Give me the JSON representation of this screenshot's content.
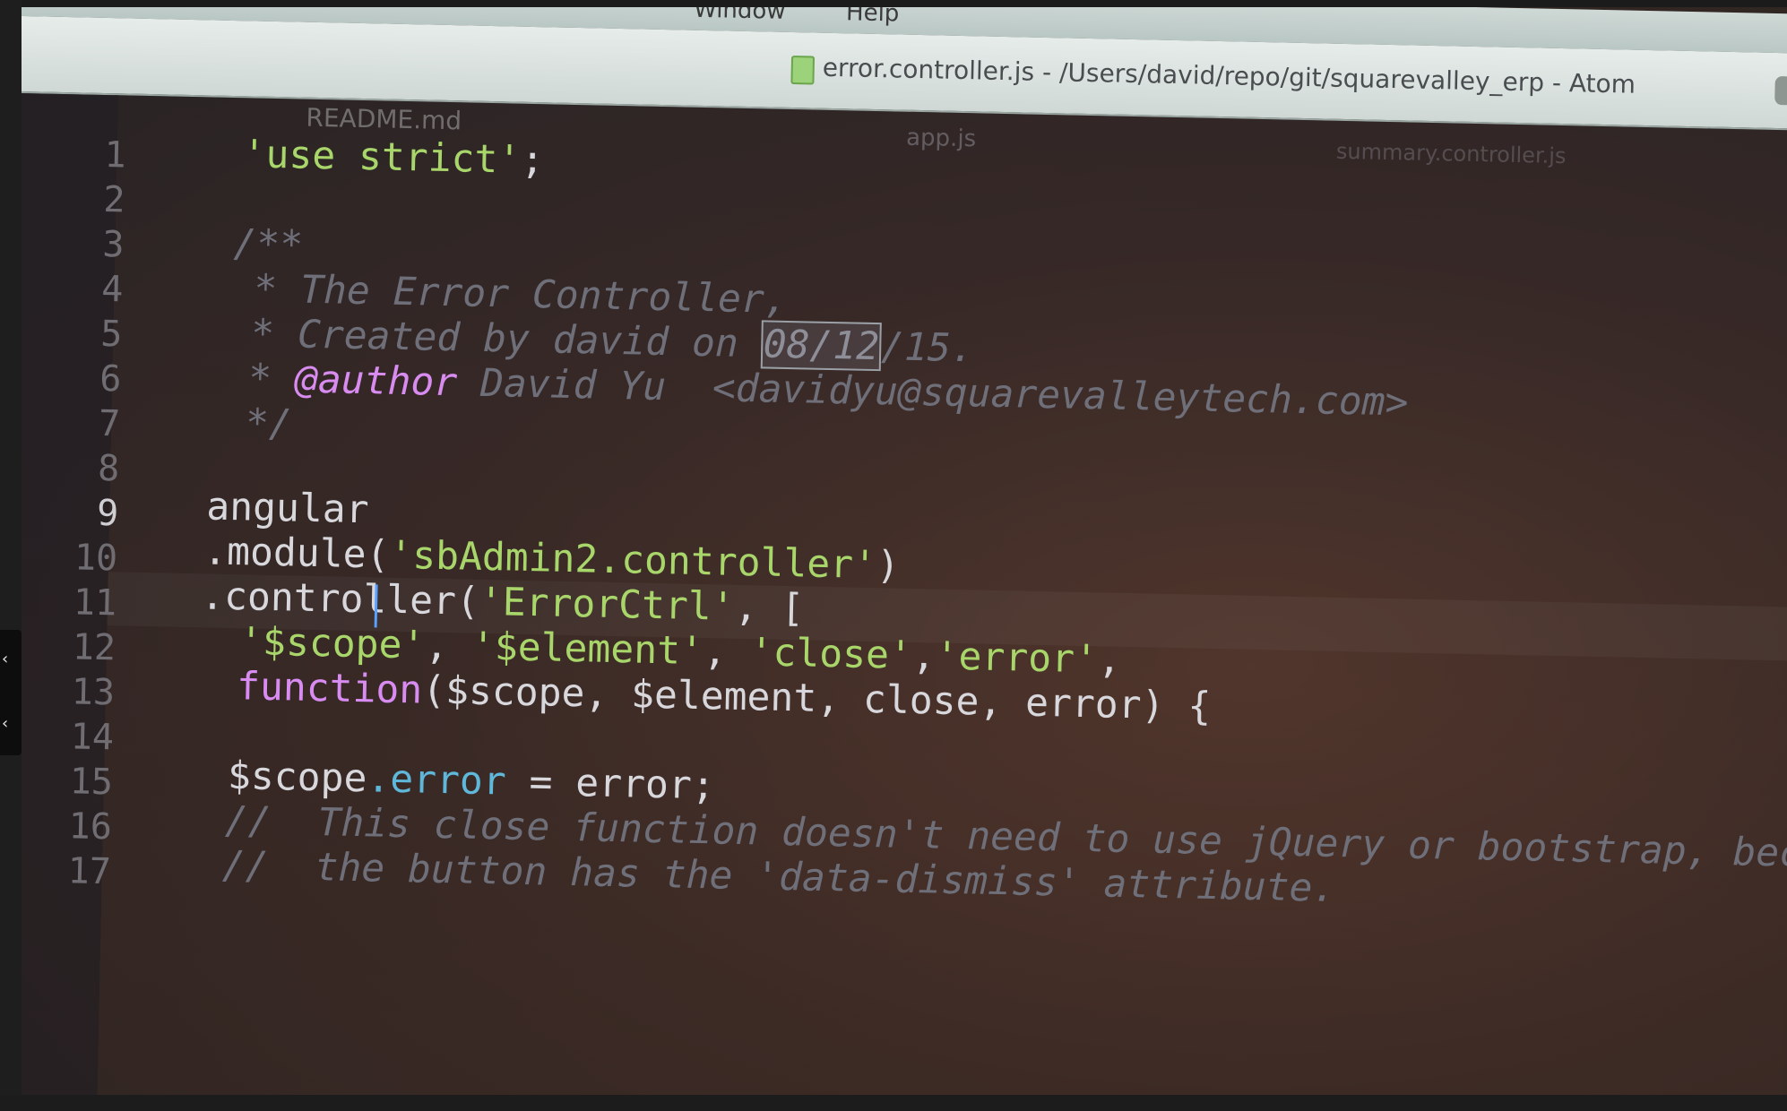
{
  "menu": {
    "window": "Window",
    "help": "Help"
  },
  "title": {
    "text": "error.controller.js - /Users/david/repo/git/squarevalley_erp - Atom"
  },
  "tabs": {
    "readme": "README.md",
    "app": "app.js",
    "summary": "summary.controller.js"
  },
  "editor": {
    "active_line": 9,
    "line_numbers": [
      "1",
      "2",
      "3",
      "4",
      "5",
      "6",
      "7",
      "8",
      "9",
      "10",
      "11",
      "12",
      "13",
      "14",
      "15",
      "16",
      "17"
    ],
    "lines": {
      "l1_str": "'use strict'",
      "l1_punct": ";",
      "l3": "/**",
      "l4": " * The Error Controller,",
      "l5_a": " * Created by david on ",
      "l5_sel": "08/12",
      "l5_b": "/15.",
      "l6_star": " * ",
      "l6_tag": "@author",
      "l6_rest": " David Yu  <davidyu@squarevalleytech.com>",
      "l7": " */",
      "l9": "angular",
      "l10_a": ".module(",
      "l10_str": "'sbAdmin2.controller'",
      "l10_b": ")",
      "l11_a": ".controller(",
      "l11_str": "'ErrorCtrl'",
      "l11_b": ", [",
      "l12_s1": "'$scope'",
      "l12_c1": ", ",
      "l12_s2": "'$element'",
      "l12_c2": ", ",
      "l12_s3": "'close'",
      "l12_c3": ",",
      "l12_s4": "'error'",
      "l12_c4": ",",
      "l13_kw": "function",
      "l13_rest": "($scope, $element, close, error) {",
      "l15_a": "$scope",
      "l15_prop": ".error",
      "l15_b": " = error;",
      "l16": "//  This close function doesn't need to use jQuery or bootstrap, beca",
      "l17": "//  the button has the 'data-dismiss' attribute."
    }
  },
  "side_toggle": {
    "top_glyph": "‹",
    "bottom_glyph": "‹"
  }
}
